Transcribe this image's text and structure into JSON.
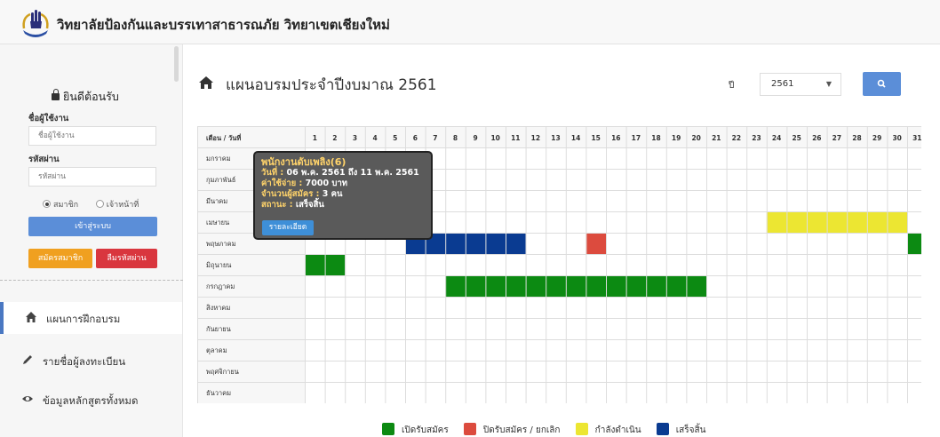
{
  "header": {
    "site_title": "วิทยาลัยป้องกันและบรรเทาสาธารณภัย วิทยาเขตเชียงใหม่"
  },
  "sidebar": {
    "welcome": "ยินดีต้อนรับ",
    "username_label": "ชื่อผู้ใช้งาน",
    "username_placeholder": "ชื่อผู้ใช้งาน",
    "password_label": "รหัสผ่าน",
    "password_placeholder": "รหัสผ่าน",
    "radio_member": "สมาชิก",
    "radio_staff": "เจ้าหน้าที่",
    "login_button": "เข้าสู่ระบบ",
    "register_button": "สมัครสมาชิก",
    "forgot_button": "ลืมรหัสผ่าน",
    "menu": [
      {
        "label": "แผนการฝึกอบรม",
        "icon": "home-icon",
        "active": true
      },
      {
        "label": "รายชื่อผู้ลงทะเบียน",
        "icon": "pencil-icon",
        "active": false
      },
      {
        "label": "ข้อมูลหลักสูตรทั้งหมด",
        "icon": "eye-icon",
        "active": false
      }
    ]
  },
  "main": {
    "title": "แผนอบรมประจำปีงบมาณ 2561",
    "year_label": "ปี",
    "year_value": "2561"
  },
  "schedule": {
    "corner_label": "เดือน / วันที่",
    "days": [
      "1",
      "2",
      "3",
      "4",
      "5",
      "6",
      "7",
      "8",
      "9",
      "10",
      "11",
      "12",
      "13",
      "14",
      "15",
      "16",
      "17",
      "18",
      "19",
      "20",
      "21",
      "22",
      "23",
      "24",
      "25",
      "26",
      "27",
      "28",
      "29",
      "30",
      "31"
    ],
    "months": [
      "มกราคม",
      "กุมภาพันธ์",
      "มีนาคม",
      "เมษายน",
      "พฤษภาคม",
      "มิถุนายน",
      "กรกฎาคม",
      "สิงหาคม",
      "กันยายน",
      "ตุลาคม",
      "พฤศจิกายน",
      "ธันวาคม"
    ],
    "colors": {
      "open": "#0c8a12",
      "closed": "#dc4b3e",
      "ongoing": "#ece632",
      "finished": "#0a3b91"
    },
    "bars": [
      {
        "month": 4,
        "start": 6,
        "end": 11,
        "status": "finished"
      },
      {
        "month": 4,
        "start": 15,
        "end": 15,
        "status": "closed"
      },
      {
        "month": 4,
        "start": 31,
        "end": 31,
        "status": "open"
      },
      {
        "month": 3,
        "start": 24,
        "end": 30,
        "status": "ongoing"
      },
      {
        "month": 5,
        "start": 1,
        "end": 2,
        "status": "open"
      },
      {
        "month": 6,
        "start": 8,
        "end": 20,
        "status": "open"
      }
    ]
  },
  "tooltip": {
    "title": "พนักงานดับเพลิง(6)",
    "date_key": "วันที่ :",
    "date_value": "06 พ.ค. 2561 ถึง 11 พ.ค. 2561",
    "cost_key": "ค่าใช้จ่าย :",
    "cost_value": "7000 บาท",
    "applicants_key": "จำนวนผู้สมัคร :",
    "applicants_value": "3 คน",
    "status_key": "สถานะ :",
    "status_value": "เสร็จสิ้น",
    "detail_button": "รายละเอียด"
  },
  "legend": [
    {
      "label": "เปิดรับสมัคร",
      "color": "#0c8a12"
    },
    {
      "label": "ปิดรับสมัคร / ยกเลิก",
      "color": "#dc4b3e"
    },
    {
      "label": "กำลังดำเนิน",
      "color": "#ece632"
    },
    {
      "label": "เสร็จสิ้น",
      "color": "#0a3b91"
    }
  ]
}
